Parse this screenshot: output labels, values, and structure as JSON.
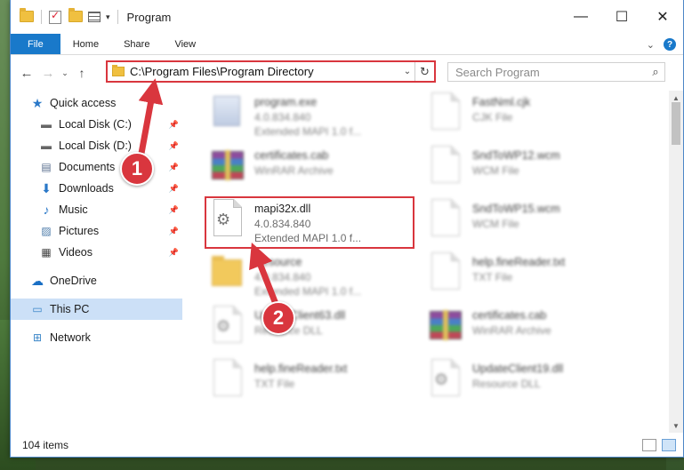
{
  "window": {
    "title": "Program"
  },
  "ribbon": {
    "tabs": [
      "File",
      "Home",
      "Share",
      "View"
    ]
  },
  "address": {
    "path": "C:\\Program Files\\Program Directory"
  },
  "search": {
    "placeholder": "Search Program"
  },
  "nav": {
    "quick_access": "Quick access",
    "items": [
      {
        "label": "Local Disk (C:)",
        "icon": "drive-icon",
        "pinned": true
      },
      {
        "label": "Local Disk (D:)",
        "icon": "drive-icon",
        "pinned": true
      },
      {
        "label": "Documents",
        "icon": "documents-icon",
        "pinned": true
      },
      {
        "label": "Downloads",
        "icon": "downloads-icon",
        "pinned": true
      },
      {
        "label": "Music",
        "icon": "music-icon",
        "pinned": true
      },
      {
        "label": "Pictures",
        "icon": "pictures-icon",
        "pinned": true
      },
      {
        "label": "Videos",
        "icon": "videos-icon",
        "pinned": true
      }
    ],
    "onedrive": "OneDrive",
    "this_pc": "This PC",
    "network": "Network"
  },
  "files": [
    {
      "name": "program.exe",
      "line2": "4.0.834.840",
      "line3": "Extended MAPI 1.0 f...",
      "type": "exe"
    },
    {
      "name": "FastNml.cjk",
      "line2": "CJK File",
      "line3": "",
      "type": "doc"
    },
    {
      "name": "certificates.cab",
      "line2": "WinRAR Archive",
      "line3": "",
      "type": "rar"
    },
    {
      "name": "SndToWP12.wcm",
      "line2": "WCM File",
      "line3": "",
      "type": "doc"
    },
    {
      "name": "mapi32x.dll",
      "line2": "4.0.834.840",
      "line3": "Extended MAPI 1.0 f...",
      "type": "dll"
    },
    {
      "name": "SndToWP15.wcm",
      "line2": "WCM File",
      "line3": "",
      "type": "doc"
    },
    {
      "name": "Resource",
      "line2": "4.0.834.840",
      "line3": "Extended MAPI 1.0 f...",
      "type": "folder"
    },
    {
      "name": "help.fineReader.txt",
      "line2": "TXT File",
      "line3": "",
      "type": "doc"
    },
    {
      "name": "UpdateClient63.dll",
      "line2": "Resource DLL",
      "line3": "",
      "type": "dll"
    },
    {
      "name": "certificates.cab",
      "line2": "WinRAR Archive",
      "line3": "",
      "type": "rar"
    },
    {
      "name": "help.fineReader.txt",
      "line2": "TXT File",
      "line3": "",
      "type": "doc"
    },
    {
      "name": "UpdateClient19.dll",
      "line2": "Resource DLL",
      "line3": "",
      "type": "dll"
    }
  ],
  "markers": [
    "1",
    "2"
  ],
  "status": {
    "item_count": "104 items"
  },
  "colors": {
    "accent": "#1979ca",
    "highlight": "#d9363e",
    "selected": "#cce0f7"
  }
}
